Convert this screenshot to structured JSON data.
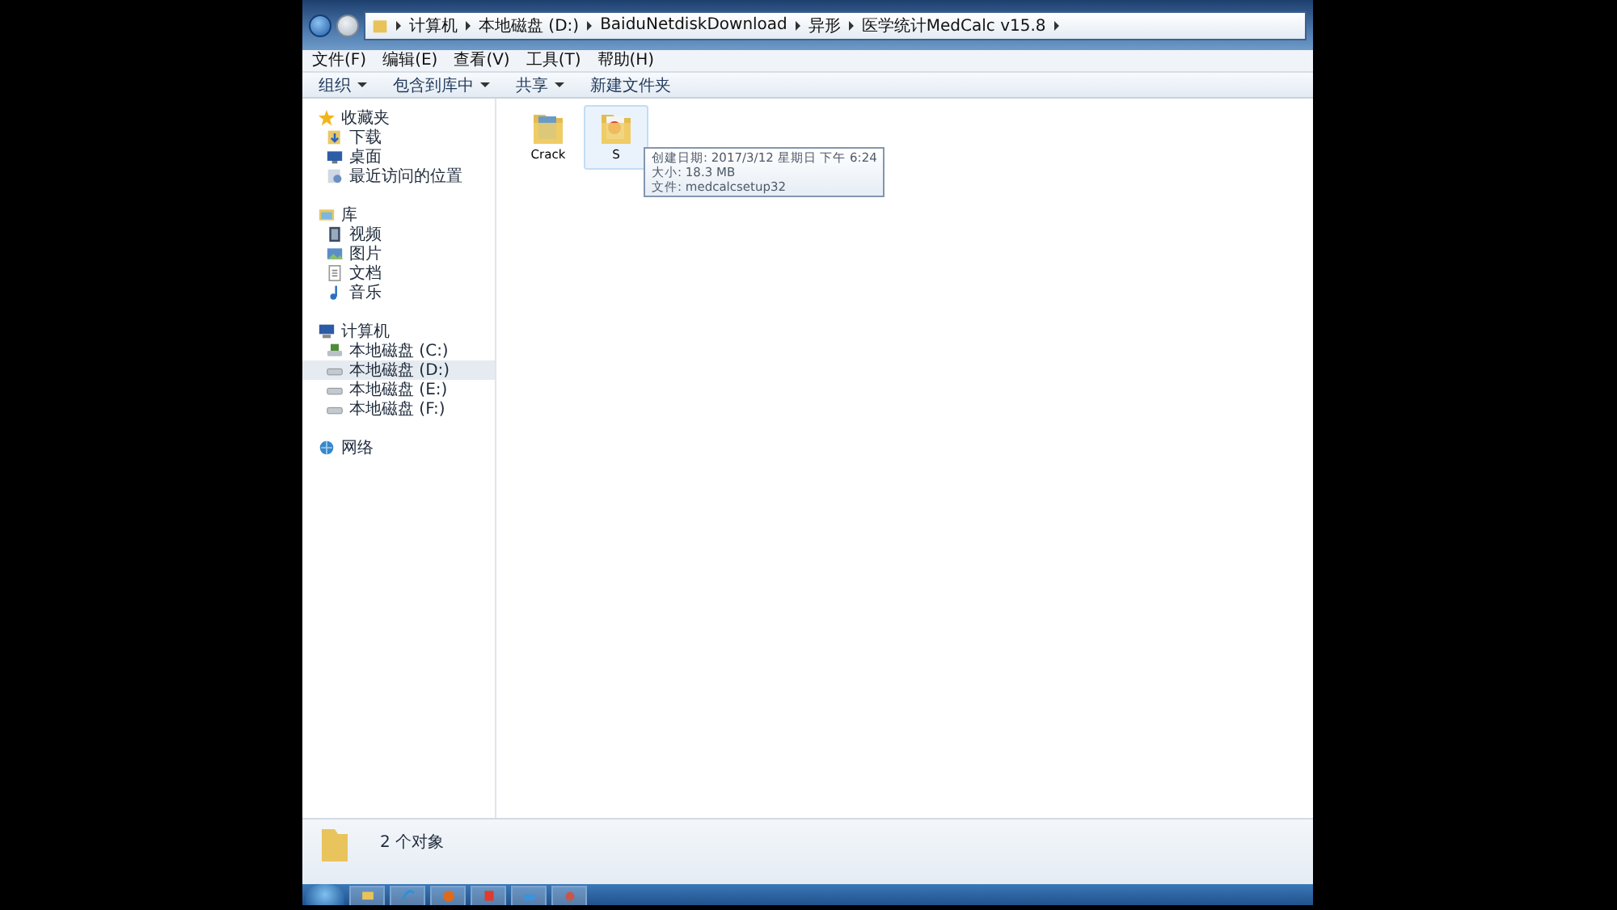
{
  "address": {
    "segments": [
      "计算机",
      "本地磁盘 (D:)",
      "BaiduNetdiskDownload",
      "异形",
      "医学统计MedCalc v15.8"
    ]
  },
  "menu": [
    "文件(F)",
    "编辑(E)",
    "查看(V)",
    "工具(T)",
    "帮助(H)"
  ],
  "toolbar": [
    {
      "label": "组织",
      "dropdown": true
    },
    {
      "label": "包含到库中",
      "dropdown": true
    },
    {
      "label": "共享",
      "dropdown": true
    },
    {
      "label": "新建文件夹",
      "dropdown": false
    }
  ],
  "sidebar": [
    {
      "label": "收藏夹",
      "kind": "star",
      "children": [
        {
          "label": "下载",
          "kind": "download",
          "selected": false
        },
        {
          "label": "桌面",
          "kind": "desktop",
          "selected": false
        },
        {
          "label": "最近访问的位置",
          "kind": "recent",
          "selected": false
        }
      ]
    },
    {
      "label": "库",
      "kind": "library",
      "children": [
        {
          "label": "视频",
          "kind": "video",
          "selected": false
        },
        {
          "label": "图片",
          "kind": "picture",
          "selected": false
        },
        {
          "label": "文档",
          "kind": "document",
          "selected": false
        },
        {
          "label": "音乐",
          "kind": "music",
          "selected": false
        }
      ]
    },
    {
      "label": "计算机",
      "kind": "computer",
      "children": [
        {
          "label": "本地磁盘 (C:)",
          "kind": "system-drive",
          "selected": false
        },
        {
          "label": "本地磁盘 (D:)",
          "kind": "drive",
          "selected": true
        },
        {
          "label": "本地磁盘 (E:)",
          "kind": "drive",
          "selected": false
        },
        {
          "label": "本地磁盘 (F:)",
          "kind": "drive",
          "selected": false
        }
      ]
    },
    {
      "label": "网络",
      "kind": "network"
    }
  ],
  "files": [
    {
      "label": "Crack",
      "selected": false
    },
    {
      "label": "S",
      "selected": true
    }
  ],
  "tooltip": [
    "创建日期: 2017/3/12 星期日 下午 6:24",
    "大小: 18.3 MB",
    "文件: medcalcsetup32"
  ],
  "status": "2 个对象"
}
